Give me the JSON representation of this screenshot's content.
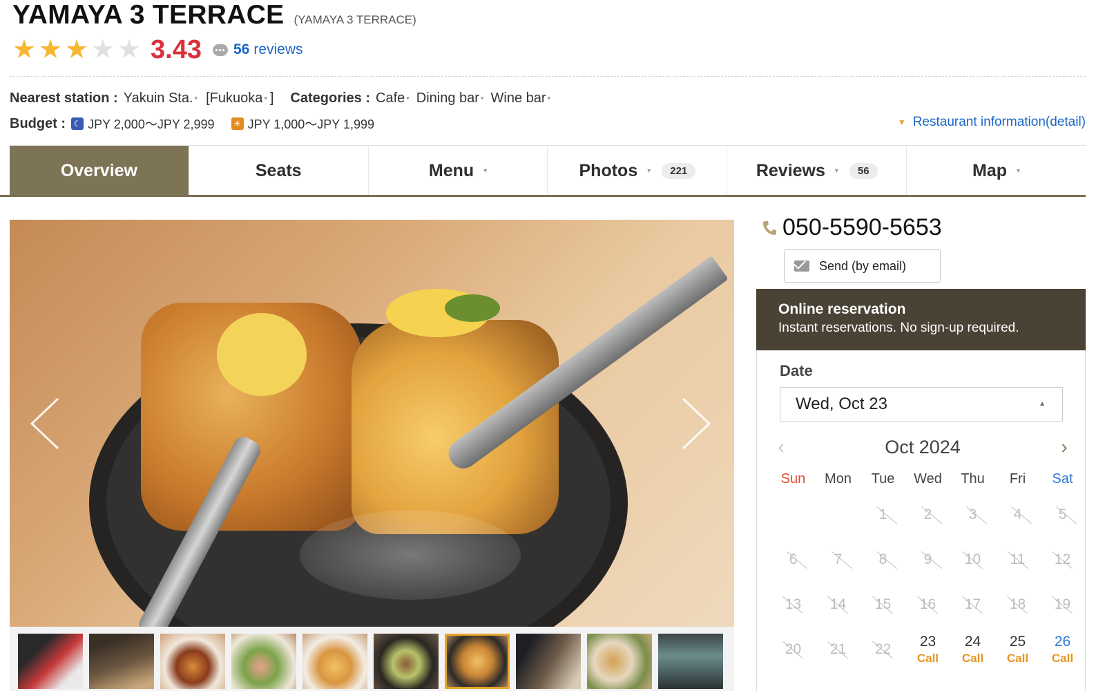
{
  "header": {
    "title": "YAMAYA 3 TERRACE",
    "subtitle": "(YAMAYA 3 TERRACE)",
    "rating": "3.43",
    "rating_stars": 3,
    "review_count": "56",
    "review_label": "reviews"
  },
  "info": {
    "station_label": "Nearest station :",
    "station": "Yakuin Sta.",
    "area": "[Fukuoka",
    "area_close": "]",
    "categories_label": "Categories :",
    "categories": [
      "Cafe",
      "Dining bar",
      "Wine bar"
    ],
    "budget_label": "Budget :",
    "dinner_budget": "JPY 2,000～JPY 2,999",
    "lunch_budget": "JPY 1,000～JPY 1,999",
    "detail_link": "Restaurant information(detail)"
  },
  "tabs": [
    {
      "label": "Overview",
      "count": ""
    },
    {
      "label": "Seats",
      "count": ""
    },
    {
      "label": "Menu",
      "count": ""
    },
    {
      "label": "Photos",
      "count": "221"
    },
    {
      "label": "Reviews",
      "count": "56"
    },
    {
      "label": "Map",
      "count": ""
    }
  ],
  "contact": {
    "phone": "050-5590-5653",
    "send_label": "Send (by email)"
  },
  "reservation": {
    "title": "Online reservation",
    "subtitle": "Instant reservations. No sign-up required.",
    "date_label": "Date",
    "selected_date": "Wed, Oct 23",
    "month": "Oct 2024",
    "weekdays": [
      "Sun",
      "Mon",
      "Tue",
      "Wed",
      "Thu",
      "Fri",
      "Sat"
    ],
    "weeks": [
      [
        "",
        "",
        "1",
        "2",
        "3",
        "4",
        "5"
      ],
      [
        "6",
        "7",
        "8",
        "9",
        "10",
        "11",
        "12"
      ],
      [
        "13",
        "14",
        "15",
        "16",
        "17",
        "18",
        "19"
      ],
      [
        "20",
        "21",
        "22",
        "23",
        "24",
        "25",
        "26"
      ]
    ],
    "available_days": [
      "23",
      "24",
      "25",
      "26"
    ],
    "call_label": "Call"
  },
  "colors": {
    "accent_tab": "#7d7355",
    "rating_red": "#d9303a",
    "link_blue": "#1a66c5",
    "call_orange": "#e8951e"
  },
  "photos": {
    "thumbnail_count": 10,
    "selected_index": 6
  }
}
